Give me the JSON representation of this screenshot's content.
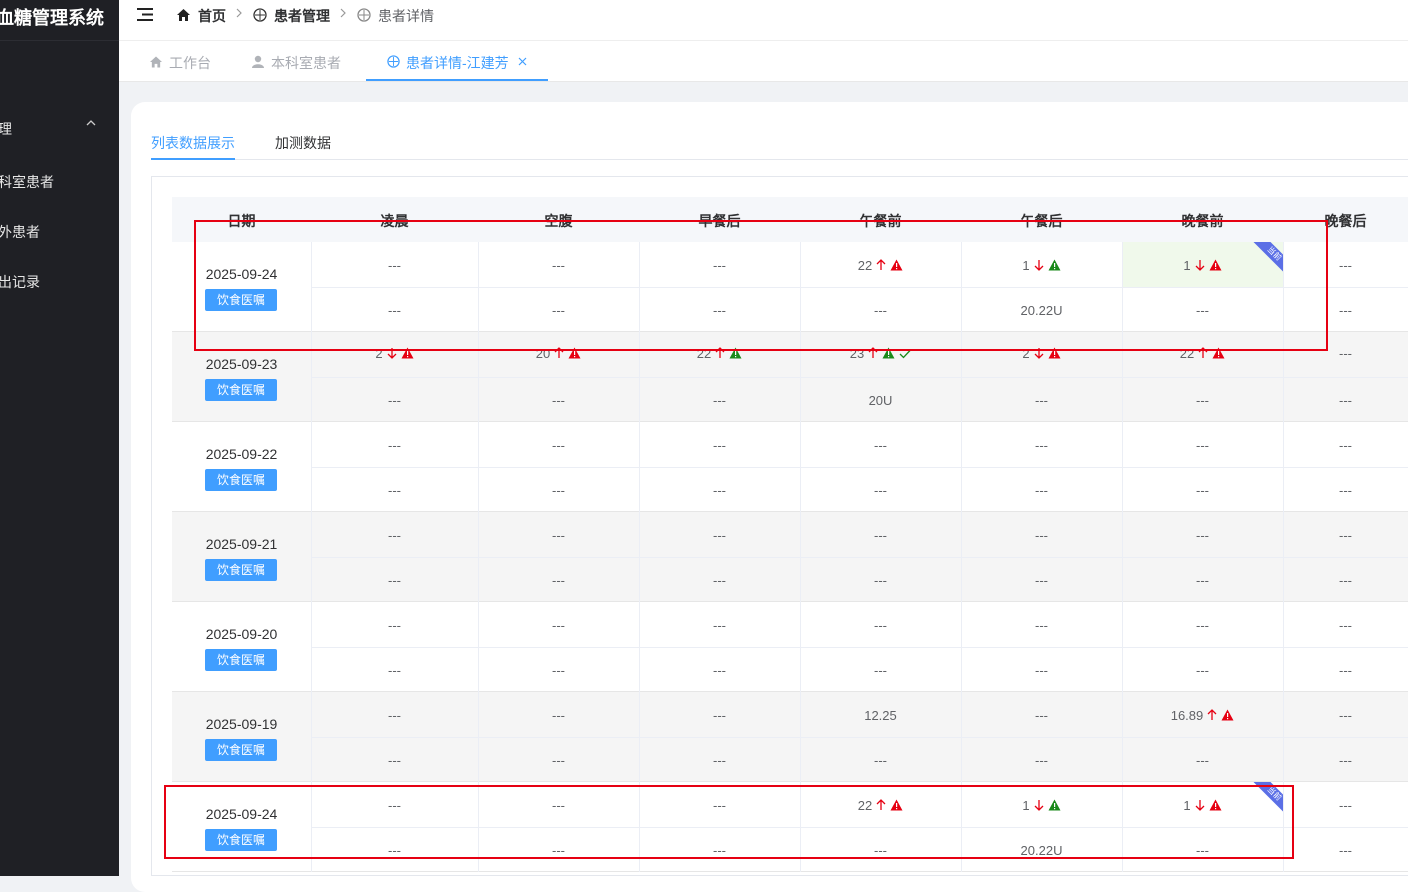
{
  "app": {
    "title": "血糖管理系统"
  },
  "sidebar": {
    "items": [
      {
        "label": "理",
        "icon": "chevron-up-icon"
      },
      {
        "label": "科室患者"
      },
      {
        "label": "外患者"
      },
      {
        "label": "出记录"
      }
    ]
  },
  "breadcrumb": [
    {
      "label": "首页",
      "icon": "home-icon"
    },
    {
      "label": "患者管理",
      "icon": "compass-icon"
    },
    {
      "label": "患者详情",
      "icon": "compass-icon"
    }
  ],
  "tabs": [
    {
      "label": "工作台",
      "icon": "home-icon"
    },
    {
      "label": "本科室患者",
      "icon": "user-icon"
    },
    {
      "label": "患者详情-江建芳",
      "icon": "compass-icon",
      "active": true
    }
  ],
  "subtabs": [
    {
      "label": "列表数据展示",
      "active": true
    },
    {
      "label": "加测数据"
    }
  ],
  "table": {
    "headers": [
      "日期",
      "凌晨",
      "空腹",
      "早餐后",
      "午餐前",
      "午餐后",
      "晚餐前",
      "晚餐后"
    ],
    "diet_label": "饮食医嘱",
    "current_badge": "当前",
    "rows": [
      {
        "date": "2025-09-24",
        "highlight_col": 6,
        "top": [
          "---",
          "---",
          "---",
          "22|up|warn-red",
          "1|down|warn-green",
          "1|down|warn-red",
          "---"
        ],
        "bottom": [
          "---",
          "---",
          "---",
          "---",
          "20.22U",
          "---",
          "---"
        ]
      },
      {
        "date": "2025-09-23",
        "top": [
          "2|down|warn-red",
          "20|up|warn-red",
          "22|up|warn-green",
          "23|up|warn-green|check",
          "2|down|warn-red",
          "22|up|warn-red",
          "---"
        ],
        "bottom": [
          "---",
          "---",
          "---",
          "20U",
          "---",
          "---",
          "---"
        ]
      },
      {
        "date": "2025-09-22",
        "top": [
          "---",
          "---",
          "---",
          "---",
          "---",
          "---",
          "---"
        ],
        "bottom": [
          "---",
          "---",
          "---",
          "---",
          "---",
          "---",
          "---"
        ]
      },
      {
        "date": "2025-09-21",
        "top": [
          "---",
          "---",
          "---",
          "---",
          "---",
          "---",
          "---"
        ],
        "bottom": [
          "---",
          "---",
          "---",
          "---",
          "---",
          "---",
          "---"
        ]
      },
      {
        "date": "2025-09-20",
        "top": [
          "---",
          "---",
          "---",
          "---",
          "---",
          "---",
          "---"
        ],
        "bottom": [
          "---",
          "---",
          "---",
          "---",
          "---",
          "---",
          "---"
        ]
      },
      {
        "date": "2025-09-19",
        "top": [
          "---",
          "---",
          "---",
          "12.25",
          "---",
          "16.89|up|warn-red",
          "---"
        ],
        "bottom": [
          "---",
          "---",
          "---",
          "---",
          "---",
          "---",
          "---"
        ]
      },
      {
        "date": "2025-09-24",
        "ribbon_col": 6,
        "top": [
          "---",
          "---",
          "---",
          "22|up|warn-red",
          "1|down|warn-green",
          "1|down|warn-red",
          "---"
        ],
        "bottom": [
          "---",
          "---",
          "---",
          "---",
          "20.22U",
          "---",
          "---"
        ]
      }
    ]
  },
  "colors": {
    "accent": "#409eff",
    "up": "#e60012",
    "down": "#e60012",
    "warn_red": "#e60012",
    "warn_green": "#1a8a1a",
    "annotation_box": "#e60012"
  }
}
